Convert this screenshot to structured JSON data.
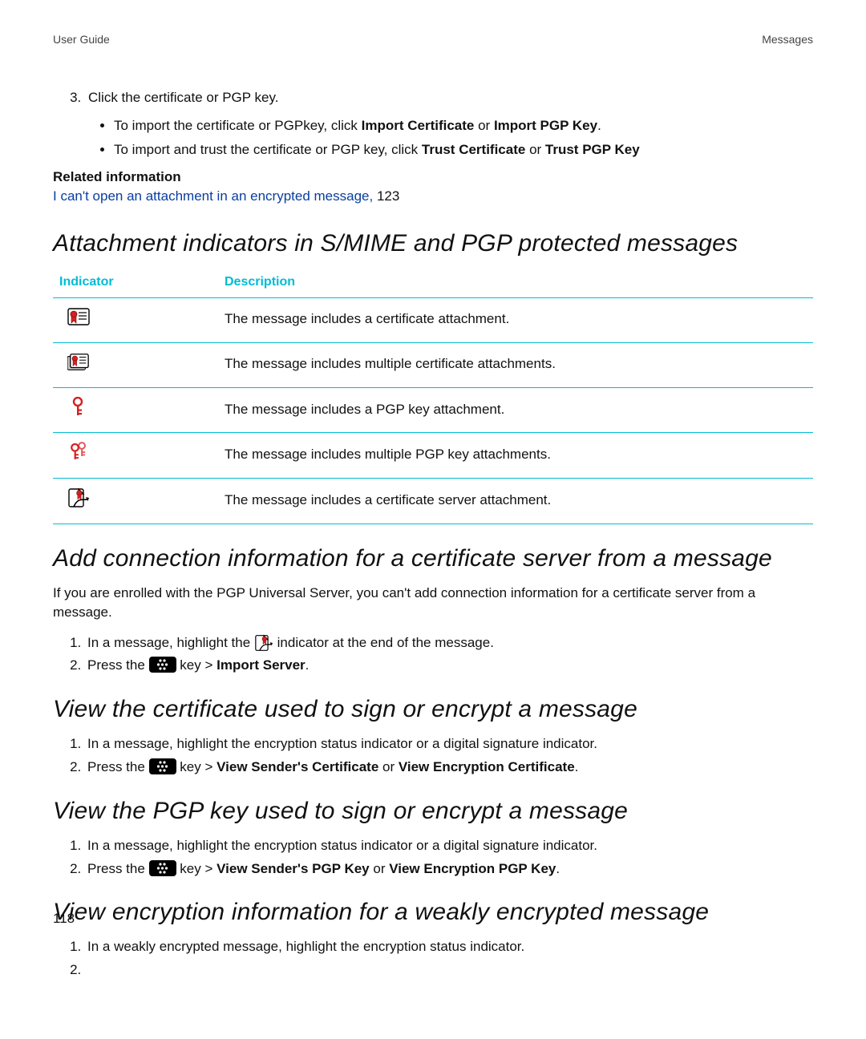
{
  "header": {
    "left": "User Guide",
    "right": "Messages"
  },
  "top_step": {
    "num": "3.",
    "text": "Click the certificate or PGP key.",
    "bullets": [
      {
        "pre": "To import the certificate or PGPkey, click ",
        "b1": "Import Certificate",
        "mid": " or ",
        "b2": "Import PGP Key",
        "post": "."
      },
      {
        "pre": "To import and trust the certificate or PGP key, click ",
        "b1": "Trust Certificate",
        "mid": " or ",
        "b2": "Trust PGP Key",
        "post": ""
      }
    ]
  },
  "related": {
    "heading": "Related information",
    "link_text": "I can't open an attachment in an encrypted message,",
    "after": " 123"
  },
  "h_indicators": "Attachment indicators in S/MIME and PGP protected messages",
  "table": {
    "col1": "Indicator",
    "col2": "Description",
    "rows": [
      {
        "icon": "cert-single-icon",
        "desc": "The message includes a certificate attachment."
      },
      {
        "icon": "cert-multi-icon",
        "desc": "The message includes multiple certificate attachments."
      },
      {
        "icon": "pgp-key-icon",
        "desc": "The message includes a PGP key attachment."
      },
      {
        "icon": "pgp-key-multi-icon",
        "desc": "The message includes multiple PGP key attachments."
      },
      {
        "icon": "cert-server-icon",
        "desc": "The message includes a certificate server attachment."
      }
    ]
  },
  "h_add_conn": "Add connection information for a certificate server from a message",
  "add_conn_para": "If you are enrolled with the PGP Universal Server, you can't add connection information for a certificate server from a message.",
  "add_conn_steps": {
    "s1_a": "In a message, highlight the ",
    "s1_b": " indicator at the end of the message.",
    "s2_a": "Press the ",
    "s2_b": " key > ",
    "s2_bold": "Import Server",
    "s2_c": "."
  },
  "h_view_cert": "View the certificate used to sign or encrypt a message",
  "view_cert_steps": {
    "s1": "In a message, highlight the encryption status indicator or a digital signature indicator.",
    "s2_a": "Press the ",
    "s2_b": " key > ",
    "s2_bold1": "View Sender's Certificate",
    "s2_mid": " or ",
    "s2_bold2": "View Encryption Certificate",
    "s2_c": "."
  },
  "h_view_pgp": "View the PGP key used to sign or encrypt a message",
  "view_pgp_steps": {
    "s1": "In a message, highlight the encryption status indicator or a digital signature indicator.",
    "s2_a": "Press the ",
    "s2_b": " key > ",
    "s2_bold1": "View Sender's PGP Key",
    "s2_mid": " or ",
    "s2_bold2": "View Encryption PGP Key",
    "s2_c": "."
  },
  "h_view_weak": "View encryption information for a weakly encrypted message",
  "view_weak_steps": {
    "s1": "In a weakly encrypted message, highlight the encryption status indicator.",
    "s2": ""
  },
  "page_number": "118"
}
